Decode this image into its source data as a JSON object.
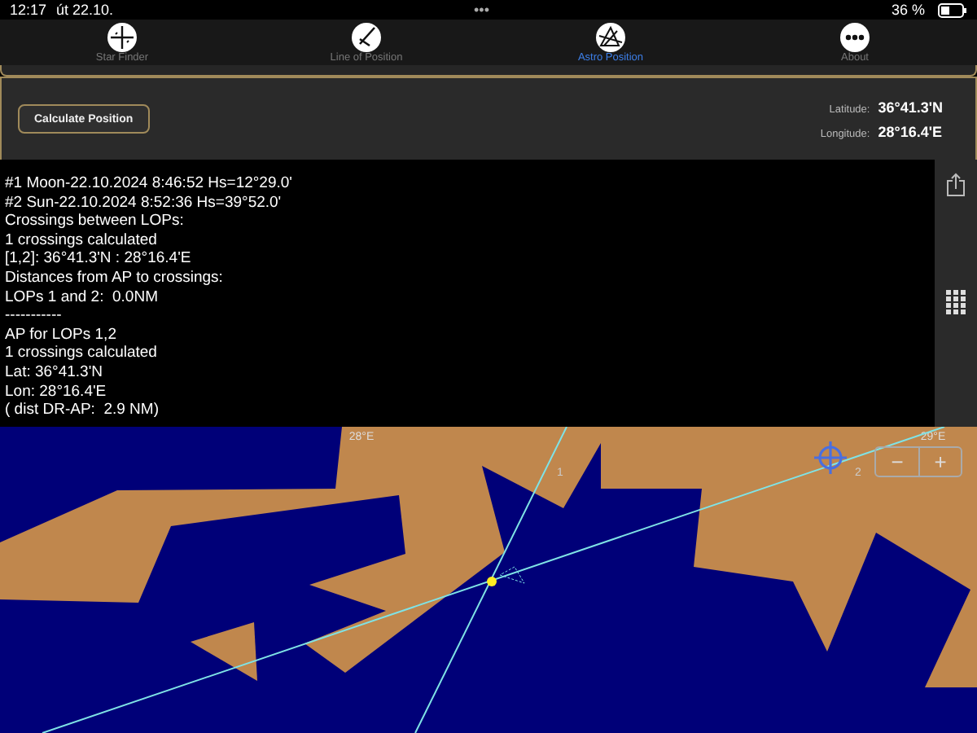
{
  "status_bar": {
    "time": "12:17",
    "date": "út 22.10.",
    "dots": "•••",
    "battery": "36 %"
  },
  "tabs": [
    {
      "label": "Star Finder",
      "kind": "compass",
      "selected": false
    },
    {
      "label": "Line of Position",
      "kind": "line",
      "selected": false
    },
    {
      "label": "Astro Position",
      "kind": "triangle",
      "selected": true
    },
    {
      "label": "About",
      "kind": "more",
      "selected": false
    }
  ],
  "panel": {
    "button": "Calculate Position",
    "fields": [
      {
        "label": "Latitude:",
        "value": "36°41.3'N"
      },
      {
        "label": "Longitude:",
        "value": "28°16.4'E"
      }
    ]
  },
  "output_lines": [
    "#1 Moon-22.10.2024 8:46:52 Hs=12°29.0'",
    "#2 Sun-22.10.2024 8:52:36 Hs=39°52.0'",
    "Crossings between LOPs:",
    "1 crossings calculated",
    "[1,2]: 36°41.3'N : 28°16.4'E",
    "Distances from AP to crossings:",
    "LOPs 1 and 2:  0.0NM",
    "-----------",
    "AP for LOPs 1,2",
    "1 crossings calculated",
    "Lat: 36°41.3'N",
    "Lon: 28°16.4'E",
    "( dist DR-AP:  2.9 NM)"
  ],
  "map": {
    "grid_labels": [
      "28°E",
      "29°E"
    ],
    "lop_labels": [
      "1",
      "2"
    ],
    "zoom_buttons": [
      "−",
      "+"
    ]
  }
}
